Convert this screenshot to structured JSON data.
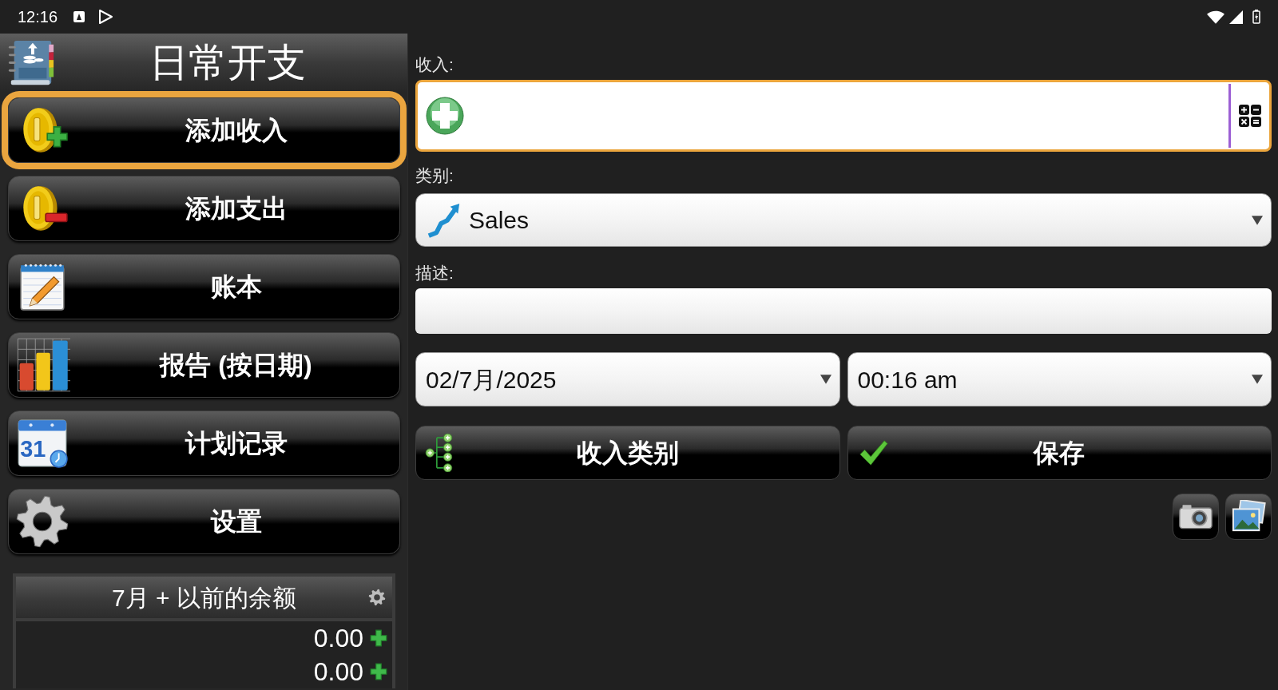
{
  "status_bar": {
    "time": "12:16"
  },
  "sidebar": {
    "title": "日常开支",
    "items": [
      {
        "label": "添加收入",
        "kind": "add_income",
        "selected": true
      },
      {
        "label": "添加支出",
        "kind": "add_expense",
        "selected": false
      },
      {
        "label": "账本",
        "kind": "ledger",
        "selected": false
      },
      {
        "label": "报告 (按日期)",
        "kind": "report",
        "selected": false
      },
      {
        "label": "计划记录",
        "kind": "schedule",
        "selected": false,
        "icon_text": "31"
      },
      {
        "label": "设置",
        "kind": "settings",
        "selected": false
      }
    ]
  },
  "balance": {
    "title": "7月 + 以前的余额",
    "rows": [
      {
        "amount": "0.00"
      },
      {
        "amount": "0.00"
      }
    ]
  },
  "form": {
    "income": {
      "label": "收入:",
      "focused": true
    },
    "category": {
      "label": "类别:",
      "value": "Sales"
    },
    "description": {
      "label": "描述:"
    },
    "date": {
      "value": "02/7月/2025"
    },
    "time": {
      "value": "00:16 am"
    },
    "buttons": [
      {
        "label": "收入类别",
        "kind": "categories"
      },
      {
        "label": "保存",
        "kind": "save"
      }
    ],
    "attachments": [
      {
        "kind": "camera"
      },
      {
        "kind": "gallery"
      }
    ]
  }
}
